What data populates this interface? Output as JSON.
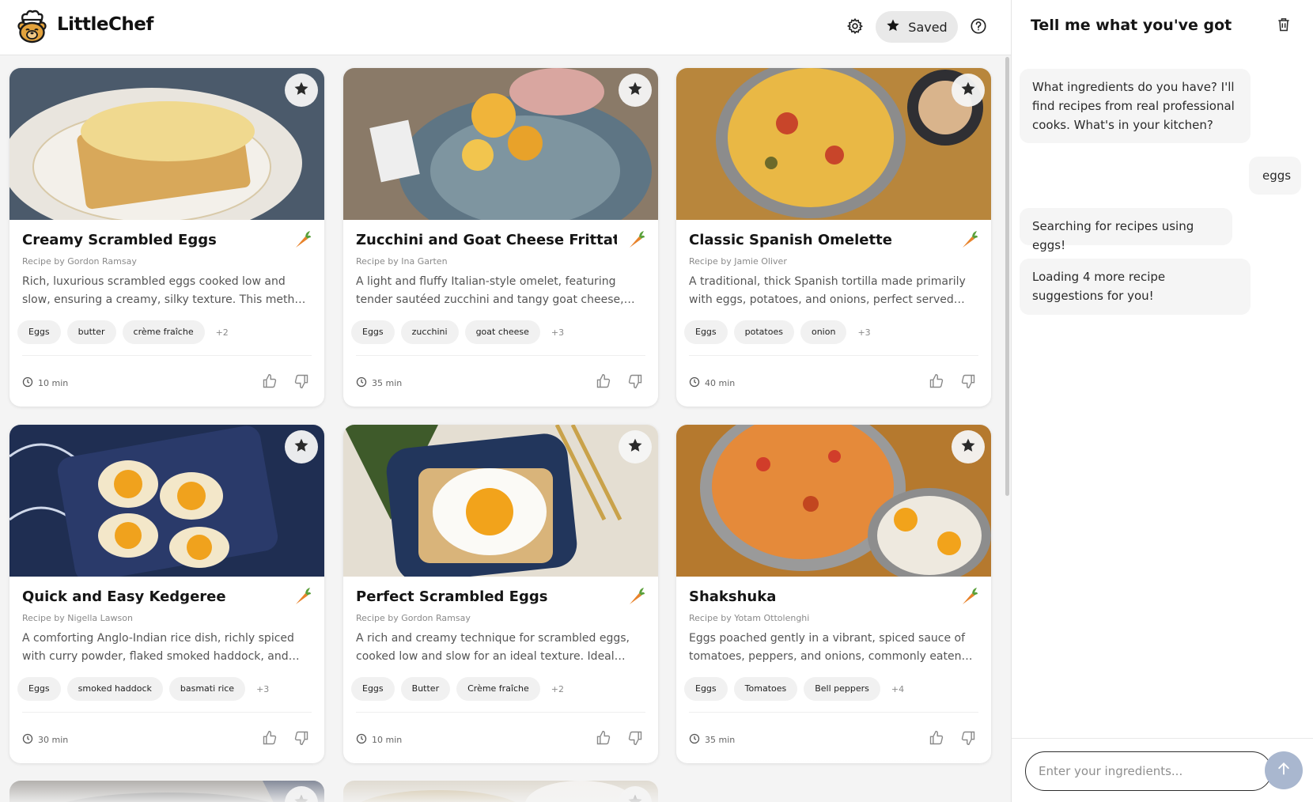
{
  "app": {
    "name": "LittleChef"
  },
  "header": {
    "saved_label": "Saved"
  },
  "recipes": [
    {
      "title": "Creamy Scrambled Eggs",
      "author": "Recipe by Gordon Ramsay",
      "description": "Rich, luxurious scrambled eggs cooked low and slow, ensuring a creamy, silky texture. This method involves…",
      "tags": [
        "Eggs",
        "butter",
        "crème fraîche"
      ],
      "more": "+2",
      "time": "10 min"
    },
    {
      "title": "Zucchini and Goat Cheese Frittata",
      "author": "Recipe by Ina Garten",
      "description": "A light and fluffy Italian-style omelet, featuring tender sautéed zucchini and tangy goat cheese, finished in the…",
      "tags": [
        "Eggs",
        "zucchini",
        "goat cheese"
      ],
      "more": "+3",
      "time": "35 min"
    },
    {
      "title": "Classic Spanish Omelette",
      "author": "Recipe by Jamie Oliver",
      "description": "A traditional, thick Spanish tortilla made primarily with eggs, potatoes, and onions, perfect served warm or at…",
      "tags": [
        "Eggs",
        "potatoes",
        "onion"
      ],
      "more": "+3",
      "time": "40 min"
    },
    {
      "title": "Quick and Easy Kedgeree",
      "author": "Recipe by Nigella Lawson",
      "description": "A comforting Anglo-Indian rice dish, richly spiced with curry powder, flaked smoked haddock, and garnished wit…",
      "tags": [
        "Eggs",
        "smoked haddock",
        "basmati rice"
      ],
      "more": "+3",
      "time": "30 min"
    },
    {
      "title": "Perfect Scrambled Eggs",
      "author": "Recipe by Gordon Ramsay",
      "description": "A rich and creamy technique for scrambled eggs, cooked low and slow for an ideal texture. Ideal served on…",
      "tags": [
        "Eggs",
        "Butter",
        "Crème fraîche"
      ],
      "more": "+2",
      "time": "10 min"
    },
    {
      "title": "Shakshuka",
      "author": "Recipe by Yotam Ottolenghi",
      "description": "Eggs poached gently in a vibrant, spiced sauce of tomatoes, peppers, and onions, commonly eaten for…",
      "tags": [
        "Eggs",
        "Tomatoes",
        "Bell peppers"
      ],
      "more": "+4",
      "time": "35 min"
    }
  ],
  "chat": {
    "title": "Tell me what you've got",
    "messages": [
      {
        "role": "assistant",
        "text": "What ingredients do you have? I'll find recipes from real professional cooks. What's in your kitchen?"
      },
      {
        "role": "user",
        "text": "eggs"
      },
      {
        "role": "assistant",
        "text": "Searching for recipes using eggs!"
      },
      {
        "role": "assistant",
        "text": "Loading 4 more recipe suggestions for you!"
      }
    ],
    "input_placeholder": "Enter your ingredients..."
  },
  "icons": {
    "logo": "chef-bear-logo",
    "settings": "gear-icon",
    "saved": "star-icon",
    "help": "help-icon",
    "favorite": "star-icon",
    "ingredient_source": "carrot-icon",
    "time": "clock-icon",
    "like": "thumbs-up-icon",
    "dislike": "thumbs-down-icon",
    "clear_chat": "trash-icon",
    "send": "arrow-up-icon"
  },
  "colors": {
    "send_button": "#a9b7cf",
    "background": "#f4f4f4",
    "tag_bg": "#f1f1f1"
  }
}
